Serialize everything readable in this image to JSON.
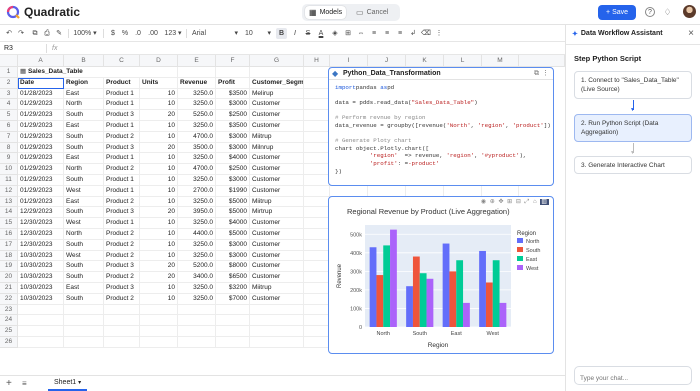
{
  "app": {
    "name": "Quadratic",
    "mode_models": "Models",
    "mode_cancel": "Cancel",
    "save_label": "Save",
    "accent": "#2563eb"
  },
  "toolbar": {
    "zoom": "100%",
    "currency": "$",
    "percent": "%",
    "dec_less": ".0",
    "dec_more": ".00",
    "num_format": "123",
    "font": "Arial",
    "font_size": "10",
    "bold": "B",
    "italic": "I",
    "strike": "S",
    "color": "A"
  },
  "formula_bar": {
    "cell_ref": "R3",
    "fx": "fx"
  },
  "grid": {
    "columns": [
      "A",
      "B",
      "C",
      "D",
      "E",
      "F",
      "G",
      "H",
      "I",
      "J",
      "K",
      "L",
      "M"
    ],
    "rows": [
      "1",
      "2",
      "3",
      "4",
      "5",
      "6",
      "7",
      "8",
      "9",
      "10",
      "11",
      "12",
      "13",
      "14",
      "15",
      "16",
      "17",
      "18",
      "19",
      "20",
      "21",
      "22",
      "23",
      "24",
      "25",
      "26"
    ],
    "table_name": "Sales_Data_Table",
    "headers": [
      "Date",
      "Region",
      "Product",
      "Units",
      "Revenue",
      "Profit",
      "Customer_Segment"
    ],
    "data": [
      [
        "01/28/2023",
        "East",
        "Product 1",
        "10",
        "3250.0",
        "$3500",
        "Melirup"
      ],
      [
        "01/29/2023",
        "North",
        "Product 1",
        "10",
        "3250.0",
        "$3000",
        "Customer"
      ],
      [
        "01/29/2023",
        "South",
        "Product 3",
        "20",
        "5250.0",
        "$2500",
        "Customer"
      ],
      [
        "01/29/2023",
        "East",
        "Product 1",
        "10",
        "3250.0",
        "$3500",
        "Customer"
      ],
      [
        "01/29/2023",
        "South",
        "Product 2",
        "10",
        "4700.0",
        "$3000",
        "Miitrup"
      ],
      [
        "01/29/2023",
        "South",
        "Product 3",
        "20",
        "3500.0",
        "$3000",
        "Milnrup"
      ],
      [
        "01/29/2023",
        "East",
        "Product 1",
        "10",
        "3250.0",
        "$4000",
        "Customer"
      ],
      [
        "01/29/2023",
        "North",
        "Product 2",
        "10",
        "4700.0",
        "$2500",
        "Customer"
      ],
      [
        "01/29/2023",
        "South",
        "Product 1",
        "10",
        "3250.0",
        "$3000",
        "Customer"
      ],
      [
        "01/29/2023",
        "West",
        "Product 1",
        "10",
        "2700.0",
        "$1990",
        "Customer"
      ],
      [
        "01/29/2023",
        "East",
        "Product 2",
        "10",
        "3250.0",
        "$5000",
        "Miitrup"
      ],
      [
        "12/29/2023",
        "South",
        "Product 3",
        "20",
        "3950.0",
        "$5000",
        "Mirtrup"
      ],
      [
        "12/30/2023",
        "West",
        "Product 1",
        "10",
        "3250.0",
        "$4000",
        "Customer"
      ],
      [
        "12/30/2023",
        "North",
        "Product 2",
        "10",
        "4400.0",
        "$5000",
        "Customer"
      ],
      [
        "12/30/2023",
        "South",
        "Product 2",
        "10",
        "3250.0",
        "$3000",
        "Customer"
      ],
      [
        "10/30/2023",
        "West",
        "Product 2",
        "10",
        "3250.0",
        "$3000",
        "Customer"
      ],
      [
        "10/30/2023",
        "South",
        "Product 3",
        "20",
        "5200.0",
        "$8000",
        "Customer"
      ],
      [
        "10/30/2023",
        "South",
        "Product 2",
        "20",
        "3400.0",
        "$6500",
        "Customer"
      ],
      [
        "10/30/2023",
        "East",
        "Product 3",
        "10",
        "3250.0",
        "$3200",
        "Miitrup"
      ],
      [
        "10/30/2023",
        "South",
        "Product 2",
        "10",
        "3250.0",
        "$7000",
        "Customer"
      ]
    ]
  },
  "code_pane": {
    "title": "Python_Data_Transformation",
    "lines": [
      [
        [
          "kw",
          "import"
        ],
        [
          "",
          "pandas "
        ],
        [
          "kw",
          "as"
        ],
        [
          "",
          "pd"
        ]
      ],
      [],
      [
        [
          "",
          "data = pdds.read_data("
        ],
        [
          "st",
          "\"Sales_Data_Table\""
        ],
        [
          "",
          ")"
        ]
      ],
      [],
      [
        [
          "cm",
          "# Perform revnue by region"
        ]
      ],
      [
        [
          "",
          "data_revenue = groupby([revenue("
        ],
        [
          "st",
          "'North'"
        ],
        [
          "",
          ", "
        ],
        [
          "st",
          "'region'"
        ],
        [
          "",
          ", "
        ],
        [
          "st",
          "'product'"
        ],
        [
          "",
          "])"
        ]
      ],
      [],
      [
        [
          "cm",
          "# Generate Ploty chart"
        ]
      ],
      [
        [
          "",
          "chart object.Plotly.chart(["
        ]
      ],
      [
        [
          "",
          "          "
        ],
        [
          "st",
          "'region'"
        ],
        [
          "",
          "  => revenue, "
        ],
        [
          "st",
          "'region'"
        ],
        [
          "",
          ", "
        ],
        [
          "st",
          "'#yproduct'"
        ],
        [
          "",
          "),"
        ]
      ],
      [
        [
          "",
          "          "
        ],
        [
          "st",
          "'profit'"
        ],
        [
          "",
          ": ="
        ],
        [
          "st",
          "-product'"
        ]
      ],
      [
        [
          "",
          "})"
        ]
      ]
    ]
  },
  "chart_data": {
    "type": "bar",
    "title": "Regional Revenue by Product (Live Aggregation)",
    "xlabel": "Region",
    "ylabel": "Revenue",
    "categories": [
      "North",
      "South",
      "East",
      "West"
    ],
    "ylim": [
      0,
      550000
    ],
    "yticks": [
      "0",
      "100k",
      "200k",
      "300k",
      "400k",
      "500k"
    ],
    "grid": true,
    "legend_title": "Region",
    "legend_position": "right",
    "series": [
      {
        "name": "North",
        "color": "#636efa",
        "values": [
          430000,
          220000,
          450000,
          410000
        ]
      },
      {
        "name": "South",
        "color": "#ef553b",
        "values": [
          280000,
          380000,
          300000,
          240000
        ]
      },
      {
        "name": "East",
        "color": "#00cc96",
        "values": [
          440000,
          290000,
          360000,
          360000
        ]
      },
      {
        "name": "West",
        "color": "#ab63fa",
        "values": [
          525000,
          260000,
          130000,
          130000
        ]
      }
    ]
  },
  "assistant": {
    "title": "Data Workflow Assistant",
    "heading": "Step Python Script",
    "steps": [
      "1. Connect to \"Sales_Data_Table\" (Live Source)",
      "2. Run Python Script (Data Aggregation)",
      "3. Generate Interactive Chart"
    ],
    "chat_placeholder": "Type your chat..."
  },
  "sheets": {
    "active": "Sheet1"
  }
}
